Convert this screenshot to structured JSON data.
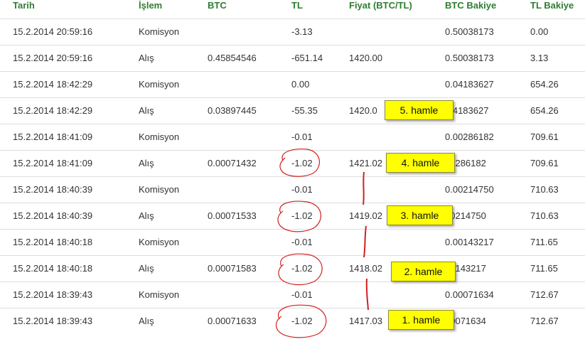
{
  "colors": {
    "header_text": "#2e7d32",
    "row_border": "#dddddd",
    "note_fill": "#ffff00",
    "annotation_red": "#d42020"
  },
  "table": {
    "columns": [
      "Tarih",
      "İşlem",
      "BTC",
      "TL",
      "Fiyat (BTC/TL)",
      "BTC Bakiye",
      "TL Bakiye"
    ],
    "rows": [
      {
        "tarih": "15.2.2014 20:59:16",
        "islem": "Komisyon",
        "btc": "",
        "tl": "-3.13",
        "fiyat": "",
        "btc_bakiye": "0.50038173",
        "tl_bakiye": "0.00"
      },
      {
        "tarih": "15.2.2014 20:59:16",
        "islem": "Alış",
        "btc": "0.45854546",
        "tl": "-651.14",
        "fiyat": "1420.00",
        "btc_bakiye": "0.50038173",
        "tl_bakiye": "3.13"
      },
      {
        "tarih": "15.2.2014 18:42:29",
        "islem": "Komisyon",
        "btc": "",
        "tl": "0.00",
        "fiyat": "",
        "btc_bakiye": "0.04183627",
        "tl_bakiye": "654.26"
      },
      {
        "tarih": "15.2.2014 18:42:29",
        "islem": "Alış",
        "btc": "0.03897445",
        "tl": "-55.35",
        "fiyat": "1420.0",
        "btc_bakiye": ".04183627",
        "tl_bakiye": "654.26"
      },
      {
        "tarih": "15.2.2014 18:41:09",
        "islem": "Komisyon",
        "btc": "",
        "tl": "-0.01",
        "fiyat": "",
        "btc_bakiye": "0.00286182",
        "tl_bakiye": "709.61"
      },
      {
        "tarih": "15.2.2014 18:41:09",
        "islem": "Alış",
        "btc": "0.00071432",
        "tl": "-1.02",
        "fiyat": "1421.02",
        "btc_bakiye": "00286182",
        "tl_bakiye": "709.61"
      },
      {
        "tarih": "15.2.2014 18:40:39",
        "islem": "Komisyon",
        "btc": "",
        "tl": "-0.01",
        "fiyat": "",
        "btc_bakiye": "0.00214750",
        "tl_bakiye": "710.63"
      },
      {
        "tarih": "15.2.2014 18:40:39",
        "islem": "Alış",
        "btc": "0.00071533",
        "tl": "-1.02",
        "fiyat": "1419.02",
        "btc_bakiye": "00214750",
        "tl_bakiye": "710.63"
      },
      {
        "tarih": "15.2.2014 18:40:18",
        "islem": "Komisyon",
        "btc": "",
        "tl": "-0.01",
        "fiyat": "",
        "btc_bakiye": "0.00143217",
        "tl_bakiye": "711.65"
      },
      {
        "tarih": "15.2.2014 18:40:18",
        "islem": "Alış",
        "btc": "0.00071583",
        "tl": "-1.02",
        "fiyat": "1418.02",
        "btc_bakiye": "00143217",
        "tl_bakiye": "711.65"
      },
      {
        "tarih": "15.2.2014 18:39:43",
        "islem": "Komisyon",
        "btc": "",
        "tl": "-0.01",
        "fiyat": "",
        "btc_bakiye": "0.00071634",
        "tl_bakiye": "712.67"
      },
      {
        "tarih": "15.2.2014 18:39:43",
        "islem": "Alış",
        "btc": "0.00071633",
        "tl": "-1.02",
        "fiyat": "1417.03",
        "btc_bakiye": "00071634",
        "tl_bakiye": "712.67"
      }
    ]
  },
  "annotations": {
    "notes": [
      "5. hamle",
      "4. hamle",
      "3. hamle",
      "2. hamle",
      "1. hamle"
    ]
  }
}
